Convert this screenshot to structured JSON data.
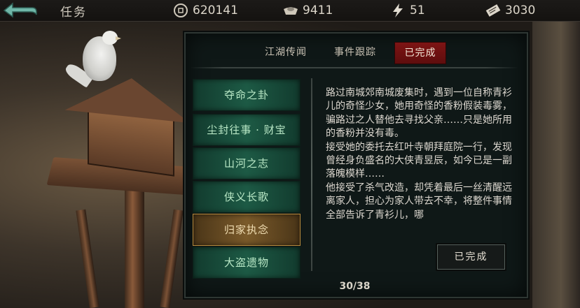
{
  "topbar": {
    "title": "任务",
    "resources": [
      {
        "icon": "copper-coin-icon",
        "value": "620141"
      },
      {
        "icon": "silver-ingot-icon",
        "value": "9411"
      },
      {
        "icon": "lightning-energy-icon",
        "value": "51"
      },
      {
        "icon": "ticket-scroll-icon",
        "value": "3030"
      }
    ]
  },
  "tabs": [
    {
      "label": "江湖传闻",
      "active": false
    },
    {
      "label": "事件跟踪",
      "active": false
    },
    {
      "label": "已完成",
      "active": true
    }
  ],
  "quests": [
    {
      "label": "夺命之卦",
      "selected": false
    },
    {
      "label": "尘封往事 · 财宝",
      "selected": false
    },
    {
      "label": "山河之志",
      "selected": false
    },
    {
      "label": "侠义长歌",
      "selected": false
    },
    {
      "label": "归家执念",
      "selected": true
    },
    {
      "label": "大盗遗物",
      "selected": false
    }
  ],
  "description": "路过南城郊南城废集时，遇到一位自称青衫儿的奇怪少女，她用奇怪的香粉假装毒雾，骗路过之人替他去寻找父亲……只是她所用的香粉并没有毒。\n接受她的委托去红叶寺朝拜庭院一行，发现曾经身负盛名的大侠青昱辰，如今已是一副落魄模样……\n他接受了杀气改造，却凭着最后一丝清醒远离家人，担心为家人带去不幸，将整件事情全部告诉了青衫儿，哪",
  "done_button": "已完成",
  "counter": "30/38",
  "colors": {
    "active_tab": "#7e1414",
    "quest_button": "#1d5a45",
    "selected_quest": "#7a5a2a"
  }
}
